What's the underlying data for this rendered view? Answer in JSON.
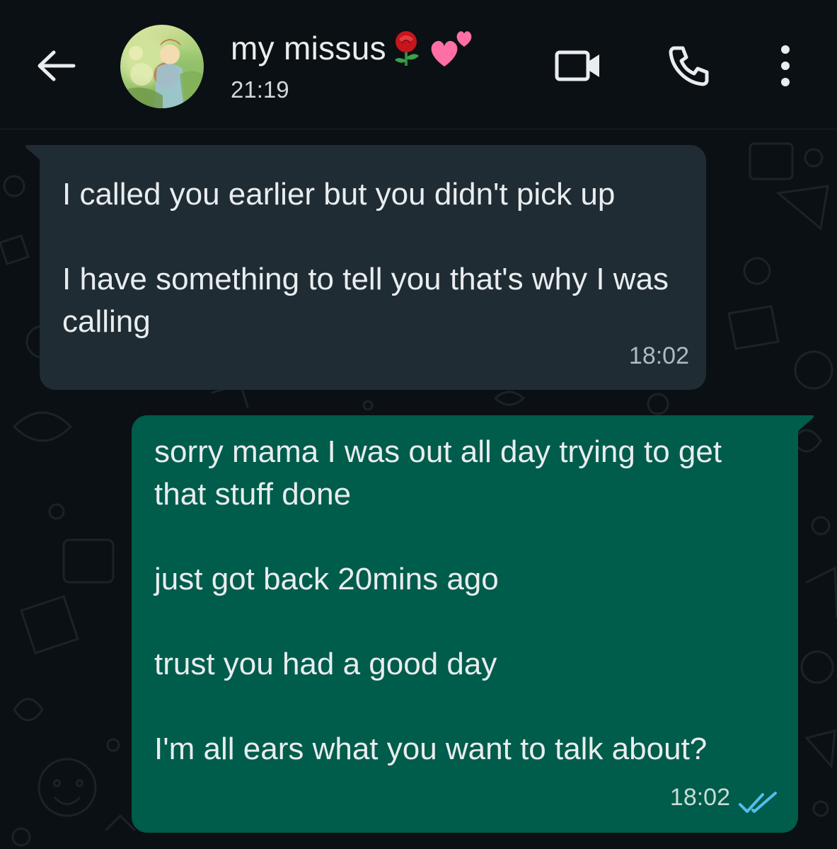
{
  "header": {
    "contact_name": "my missus",
    "name_emojis": [
      "rose-emoji",
      "two-hearts-emoji"
    ],
    "last_seen": "21:19",
    "icons": [
      "back-arrow-icon",
      "video-camera-icon",
      "phone-icon",
      "more-vertical-icon"
    ]
  },
  "messages": [
    {
      "direction": "incoming",
      "lines": [
        "I called you earlier but you didn't pick up",
        "I have something to tell you that's why I was calling"
      ],
      "time": "18:02"
    },
    {
      "direction": "outgoing",
      "lines": [
        "sorry mama I was out all day trying to get that stuff done",
        "just got back 20mins ago",
        "trust you had a good day",
        "I'm all ears what you want to talk about?"
      ],
      "time": "18:02",
      "status": "read"
    }
  ],
  "colors": {
    "background": "#0b1014",
    "incoming_bubble": "#202c33",
    "outgoing_bubble": "#005c4b",
    "read_ticks": "#53bdeb"
  }
}
